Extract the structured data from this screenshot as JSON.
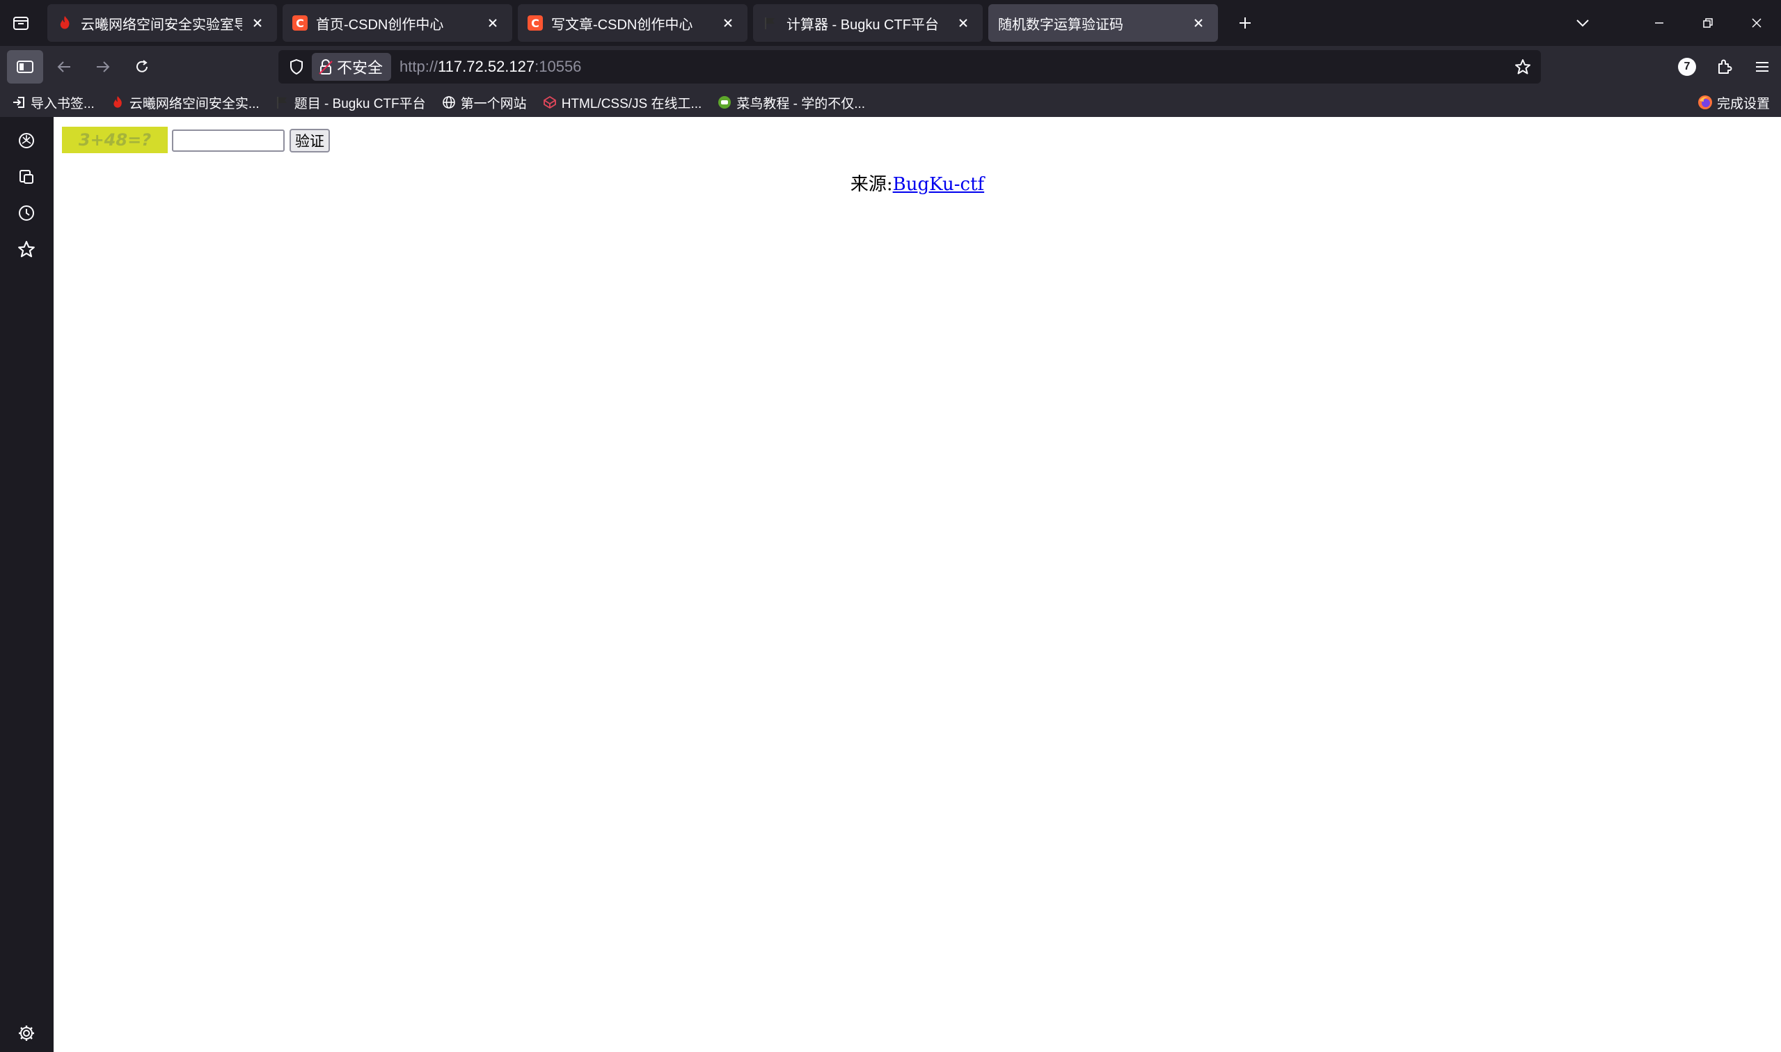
{
  "tabs": [
    {
      "title": "云曦网络空间安全实验室导航页",
      "favicon": "flame-icon",
      "active": false
    },
    {
      "title": "首页-CSDN创作中心",
      "favicon": "csdn-icon",
      "active": false
    },
    {
      "title": "写文章-CSDN创作中心",
      "favicon": "csdn-icon",
      "active": false
    },
    {
      "title": "计算器 - Bugku CTF平台",
      "favicon": "flag-icon",
      "active": false
    },
    {
      "title": "随机数字运算验证码",
      "favicon": "none",
      "active": true
    }
  ],
  "navbar": {
    "security_label": "不安全",
    "url_scheme": "http://",
    "url_host": "117.72.52.127",
    "url_port": ":10556",
    "extensions_badge": "7"
  },
  "bookmarks": [
    {
      "label": "导入书签...",
      "icon": "import-icon"
    },
    {
      "label": "云曦网络空间安全实...",
      "icon": "flame-icon"
    },
    {
      "label": "题目 - Bugku CTF平台",
      "icon": "flag-icon"
    },
    {
      "label": "第一个网站",
      "icon": "globe-icon"
    },
    {
      "label": "HTML/CSS/JS 在线工...",
      "icon": "codepen-icon"
    },
    {
      "label": "菜鸟教程 - 学的不仅...",
      "icon": "runoob-icon"
    }
  ],
  "bookmarks_right": {
    "label": "完成设置",
    "icon": "firefox-icon"
  },
  "page": {
    "captcha_text": "3+48=?",
    "answer_value": "",
    "verify_label": "验证",
    "source_prefix": "来源:",
    "source_link": "BugKu-ctf"
  },
  "colors": {
    "chrome_dark": "#1c1b22",
    "toolbar": "#2b2a33",
    "active_tab": "#42414d",
    "captcha_bg": "#d4dc2a",
    "link": "#0000ee"
  }
}
